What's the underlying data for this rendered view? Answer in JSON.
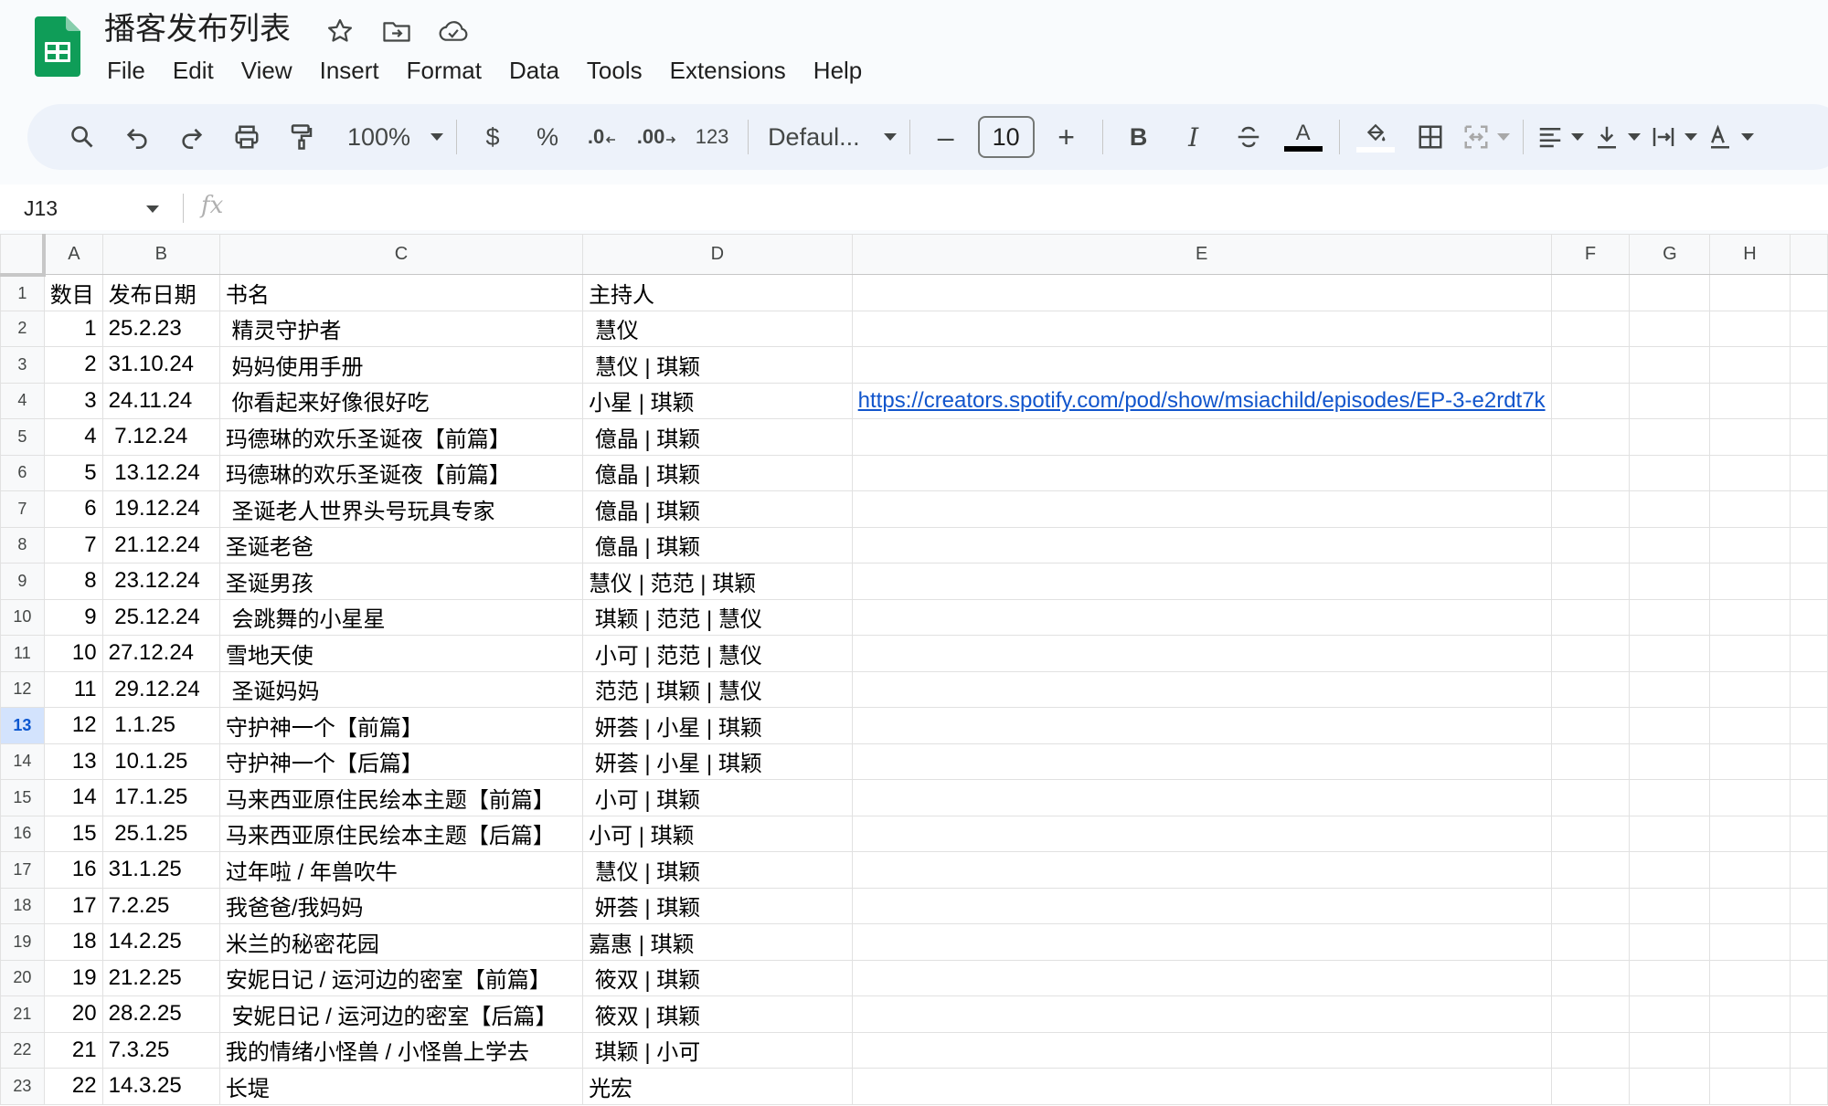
{
  "app": {
    "doc_title": "播客发布列表",
    "brand_color": "#0f9d58"
  },
  "menu": [
    "File",
    "Edit",
    "View",
    "Insert",
    "Format",
    "Data",
    "Tools",
    "Extensions",
    "Help"
  ],
  "toolbar": {
    "zoom": "100%",
    "currency": "$",
    "percent": "%",
    "decrease_decimal": ".0",
    "increase_decimal": ".00",
    "number_format": "123",
    "font_name": "Defaul...",
    "font_size": "10",
    "minus": "–",
    "plus": "+",
    "bold": "B",
    "italic": "I",
    "text_color_letter": "A"
  },
  "formula_bar": {
    "cell_ref": "J13",
    "fx": "fx",
    "value": ""
  },
  "columns": [
    "A",
    "B",
    "C",
    "D",
    "E",
    "F",
    "G",
    "H",
    ""
  ],
  "active_row": 13,
  "rows": [
    {
      "n": "1",
      "a": "数目",
      "b": "发布日期",
      "c": "书名",
      "d": "主持人",
      "e": ""
    },
    {
      "n": "2",
      "a": "1",
      "b": "25.2.23",
      "c": " 精灵守护者",
      "d": " 慧仪",
      "e": ""
    },
    {
      "n": "3",
      "a": "2",
      "b": "31.10.24",
      "c": " 妈妈使用手册",
      "d": " 慧仪 | 琪颖",
      "e": ""
    },
    {
      "n": "4",
      "a": "3",
      "b": "24.11.24",
      "c": " 你看起来好像很好吃",
      "d": "小星 | 琪颖",
      "e": "https://creators.spotify.com/pod/show/msiachild/episodes/EP-3-e2rdt7k"
    },
    {
      "n": "5",
      "a": "4",
      "b": " 7.12.24",
      "c": "玛德琳的欢乐圣诞夜【前篇】",
      "d": " 億晶 | 琪颖",
      "e": ""
    },
    {
      "n": "6",
      "a": "5",
      "b": " 13.12.24",
      "c": "玛德琳的欢乐圣诞夜【前篇】",
      "d": " 億晶 | 琪颖",
      "e": ""
    },
    {
      "n": "7",
      "a": "6",
      "b": " 19.12.24",
      "c": " 圣诞老人世界头号玩具专家",
      "d": " 億晶 | 琪颖",
      "e": ""
    },
    {
      "n": "8",
      "a": "7",
      "b": " 21.12.24",
      "c": "圣诞老爸",
      "d": " 億晶 | 琪颖",
      "e": ""
    },
    {
      "n": "9",
      "a": "8",
      "b": " 23.12.24",
      "c": "圣诞男孩",
      "d": "慧仪 | 范范 | 琪颖",
      "e": ""
    },
    {
      "n": "10",
      "a": "9",
      "b": " 25.12.24",
      "c": " 会跳舞的小星星",
      "d": " 琪颖 | 范范 | 慧仪",
      "e": ""
    },
    {
      "n": "11",
      "a": "10",
      "b": "27.12.24",
      "c": "雪地天使",
      "d": " 小可 | 范范 | 慧仪",
      "e": ""
    },
    {
      "n": "12",
      "a": "11",
      "b": " 29.12.24",
      "c": " 圣诞妈妈",
      "d": " 范范 | 琪颖 | 慧仪",
      "e": ""
    },
    {
      "n": "13",
      "a": "12",
      "b": " 1.1.25",
      "c": "守护神一个【前篇】",
      "d": " 妍荟 | 小星 | 琪颖",
      "e": ""
    },
    {
      "n": "14",
      "a": "13",
      "b": " 10.1.25",
      "c": "守护神一个【后篇】",
      "d": " 妍荟 | 小星 | 琪颖",
      "e": ""
    },
    {
      "n": "15",
      "a": "14",
      "b": " 17.1.25",
      "c": "马来西亚原住民绘本主题【前篇】",
      "d": " 小可 | 琪颖",
      "e": ""
    },
    {
      "n": "16",
      "a": "15",
      "b": " 25.1.25",
      "c": "马来西亚原住民绘本主题【后篇】",
      "d": "小可 | 琪颖",
      "e": ""
    },
    {
      "n": "17",
      "a": "16",
      "b": "31.1.25",
      "c": "过年啦 / 年兽吹牛",
      "d": " 慧仪 | 琪颖",
      "e": ""
    },
    {
      "n": "18",
      "a": "17",
      "b": "7.2.25",
      "c": "我爸爸/我妈妈",
      "d": " 妍荟 | 琪颖",
      "e": ""
    },
    {
      "n": "19",
      "a": "18",
      "b": "14.2.25",
      "c": "米兰的秘密花园",
      "d": "嘉惠 | 琪颖",
      "e": ""
    },
    {
      "n": "20",
      "a": "19",
      "b": "21.2.25",
      "c": "安妮日记 / 运河边的密室【前篇】",
      "d": " 筱双 | 琪颖",
      "e": ""
    },
    {
      "n": "21",
      "a": "20",
      "b": "28.2.25",
      "c": " 安妮日记 / 运河边的密室【后篇】",
      "d": " 筱双 | 琪颖",
      "e": ""
    },
    {
      "n": "22",
      "a": "21",
      "b": "7.3.25",
      "c": "我的情绪小怪兽 / 小怪兽上学去",
      "d": " 琪颖 | 小可",
      "e": ""
    },
    {
      "n": "23",
      "a": "22",
      "b": "14.3.25",
      "c": "长堤",
      "d": "光宏",
      "e": ""
    }
  ]
}
